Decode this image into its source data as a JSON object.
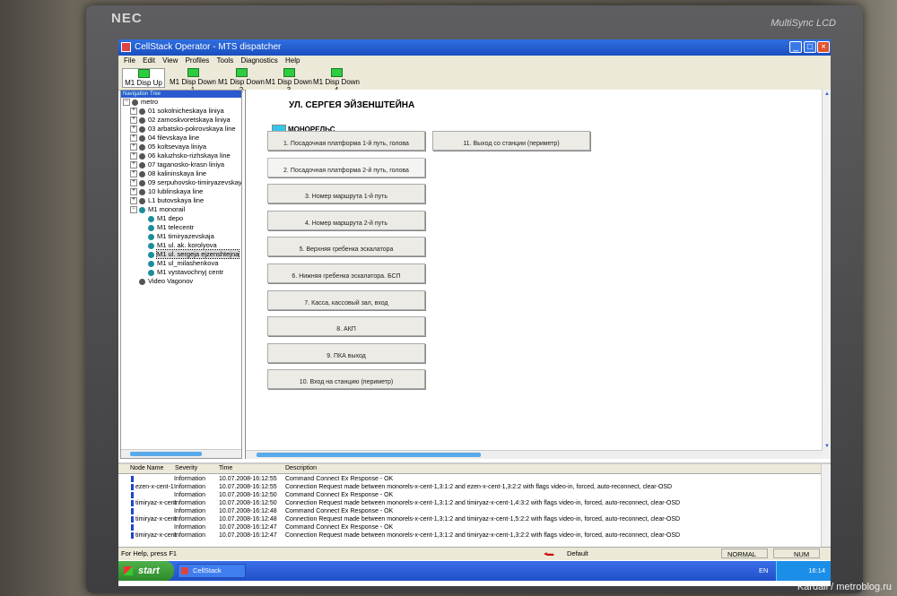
{
  "monitor": {
    "brand": "NEC",
    "model": "MultiSync LCD"
  },
  "watermark": "Kardail / metroblog.ru",
  "window": {
    "title": "CellStack Operator - MTS dispatcher"
  },
  "menu": [
    "File",
    "Edit",
    "View",
    "Profiles",
    "Tools",
    "Diagnostics",
    "Help"
  ],
  "toolbar": [
    {
      "label": "M1 Disp Up",
      "active": true
    },
    {
      "label": "M1 Disp Down 1"
    },
    {
      "label": "M1 Disp Down 2"
    },
    {
      "label": "M1 Disp Down 3"
    },
    {
      "label": "M1 Disp Down 4"
    }
  ],
  "tree": {
    "header": "Navigation Tree",
    "root": "metro",
    "lines": [
      "01 sokolnicheskaya liniya",
      "02 zamoskvoretskaya liniya",
      "03 arbatsko-pokrovskaya line",
      "04 filevskaya line",
      "05 koltsevaya liniya",
      "06 kaluzhsko-rizhskaya line",
      "07 taganosko-krasn liniya",
      "08 kalininskaya line",
      "09 serpuhovsko-timiryazevskaya li",
      "10 lublinskaya line",
      "L1 butovskaya line"
    ],
    "monorail": "M1 monorail",
    "stations": [
      "M1 depo",
      "M1 telecentr",
      "M1 timiryazevskaja",
      "M1 ul. ak. korolyova",
      "M1 ul. sergeja ejzenshtejna",
      "M1 ul_milashenkova",
      "M1 vystavochnyj centr"
    ],
    "selected": "M1 ul. sergeja ejzenshtejna",
    "extra": "Video Vagonov"
  },
  "main": {
    "station": "УЛ. СЕРГЕЯ ЭЙЗЕНШТЕЙНА",
    "legend": "МОНОРЕЛЬС",
    "legend_color": "#35c6e8",
    "buttons_left": [
      "1. Посадочная платформа 1-й путь, голова",
      "2. Посадочная платформа 2-й путь, голова",
      "3. Номер маршрута 1-й путь",
      "4. Номер маршрута 2-й путь",
      "5. Верхняя гребенка эскалатора",
      "6. Нижняя гребенка эскалатора. БСП",
      "7. Касса, кассовый зал, вход",
      "8. АКП",
      "9. ПКА выход",
      "10. Вход на станцию (периметр)"
    ],
    "buttons_right": [
      "11. Выход со станции (периметр)"
    ]
  },
  "log": {
    "columns": {
      "node": "Node Name",
      "severity": "Severity",
      "time": "Time",
      "desc": "Description"
    },
    "rows": [
      {
        "node": "",
        "severity": "Information",
        "time": "10.07.2008-16:12:55",
        "desc": "Command Connect Ex Response - OK"
      },
      {
        "node": "ezen-x-cent-1",
        "severity": "Information",
        "time": "10.07.2008-16:12:55",
        "desc": "Connection Request made between monorels-x-cent-1,3:1:2 and ezen-x-cent-1,3:2:2 with flags video-in, forced, auto-reconnect, clear-OSD"
      },
      {
        "node": "",
        "severity": "Information",
        "time": "10.07.2008-16:12:50",
        "desc": "Command Connect Ex Response - OK"
      },
      {
        "node": "timiryaz-x-cent",
        "severity": "Information",
        "time": "10.07.2008-16:12:50",
        "desc": "Connection Request made between monorels-x-cent-1,3:1:2 and timiryaz-x-cent-1,4:3:2 with flags video-in, forced, auto-reconnect, clear-OSD"
      },
      {
        "node": "",
        "severity": "Information",
        "time": "10.07.2008-16:12:48",
        "desc": "Command Connect Ex Response - OK"
      },
      {
        "node": "timiryaz-x-cent",
        "severity": "Information",
        "time": "10.07.2008-16:12:48",
        "desc": "Connection Request made between monorels-x-cent-1,3:1:2 and timiryaz-x-cent-1,5:2:2 with flags video-in, forced, auto-reconnect, clear-OSD"
      },
      {
        "node": "",
        "severity": "Information",
        "time": "10.07.2008-16:12:47",
        "desc": "Command Connect Ex Response - OK"
      },
      {
        "node": "timiryaz-x-cent",
        "severity": "Information",
        "time": "10.07.2008-16:12:47",
        "desc": "Connection Request made between monorels-x-cent-1,3:1:2 and timiryaz-x-cent-1,3:2:2 with flags video-in, forced, auto-reconnect, clear-OSD"
      }
    ]
  },
  "status": {
    "help": "For Help, press F1",
    "profile": "Default",
    "mode": "NORMAL",
    "num": "NUM"
  },
  "taskbar": {
    "start": "start",
    "task": "CellStack Operat...",
    "lang": "EN",
    "clock": "16:14"
  }
}
